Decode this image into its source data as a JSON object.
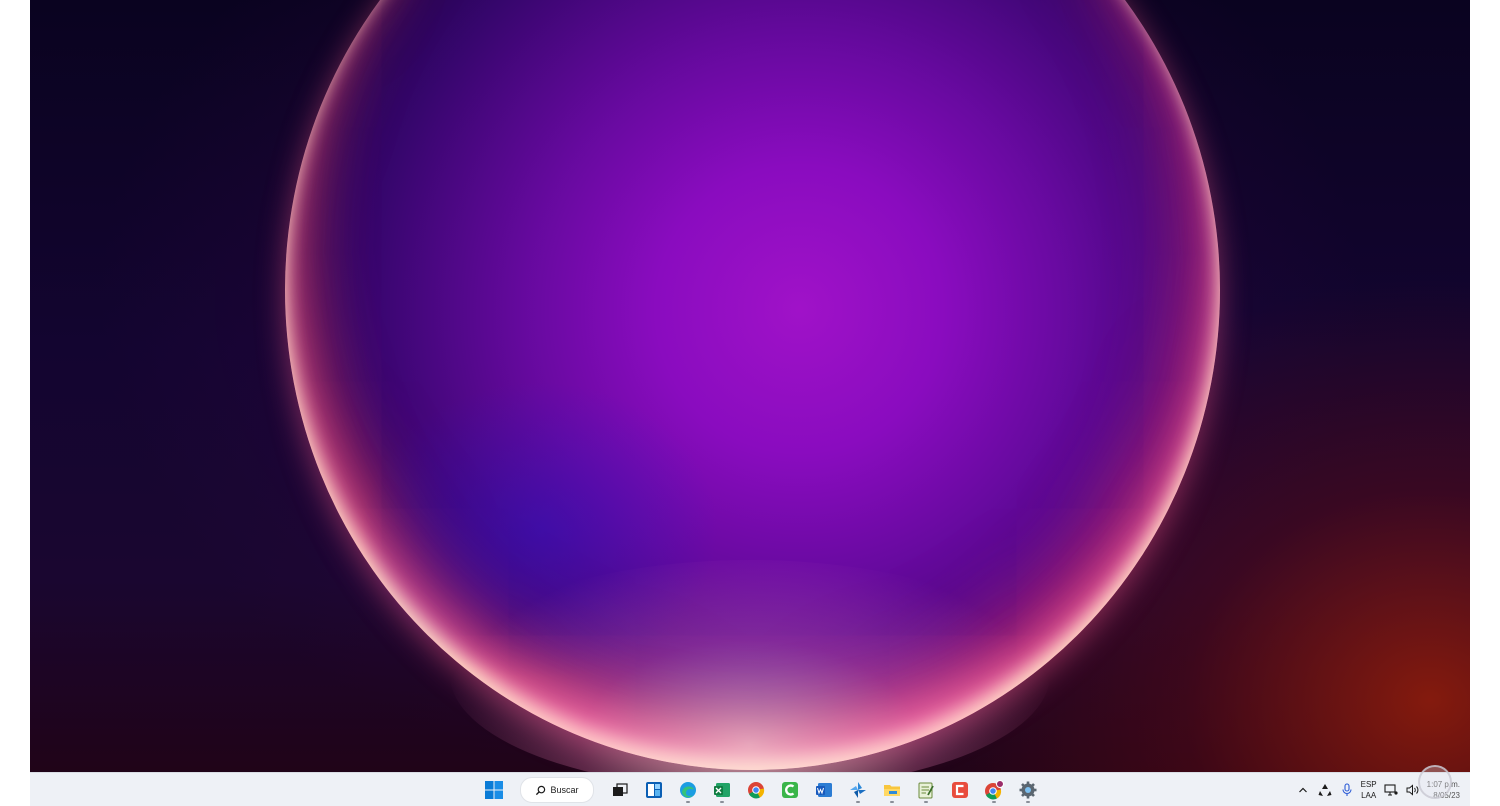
{
  "taskbar": {
    "search_label": "Buscar",
    "apps": [
      {
        "icon": "task-view-icon",
        "name": "task-view"
      },
      {
        "icon": "widgets-icon",
        "name": "widgets"
      },
      {
        "icon": "edge-icon",
        "name": "edge"
      },
      {
        "icon": "excel-icon",
        "name": "excel"
      },
      {
        "icon": "chrome-icon",
        "name": "chrome"
      },
      {
        "icon": "camtasia-icon",
        "name": "camtasia"
      },
      {
        "icon": "word-icon",
        "name": "word"
      },
      {
        "icon": "photos-icon",
        "name": "photos"
      },
      {
        "icon": "file-explorer-icon",
        "name": "file-explorer"
      },
      {
        "icon": "notepad-icon",
        "name": "notepad"
      },
      {
        "icon": "capcut-icon",
        "name": "capcut"
      },
      {
        "icon": "chrome-profile-icon",
        "name": "chrome-profile"
      },
      {
        "icon": "settings-icon",
        "name": "settings"
      }
    ],
    "tray": {
      "language_primary": "ESP",
      "language_secondary": "LAA",
      "time": "1:07 p.m.",
      "date": "8/05/23"
    }
  },
  "colors": {
    "taskbar_bg": "#eef1f6",
    "accent": "#0067c0"
  }
}
